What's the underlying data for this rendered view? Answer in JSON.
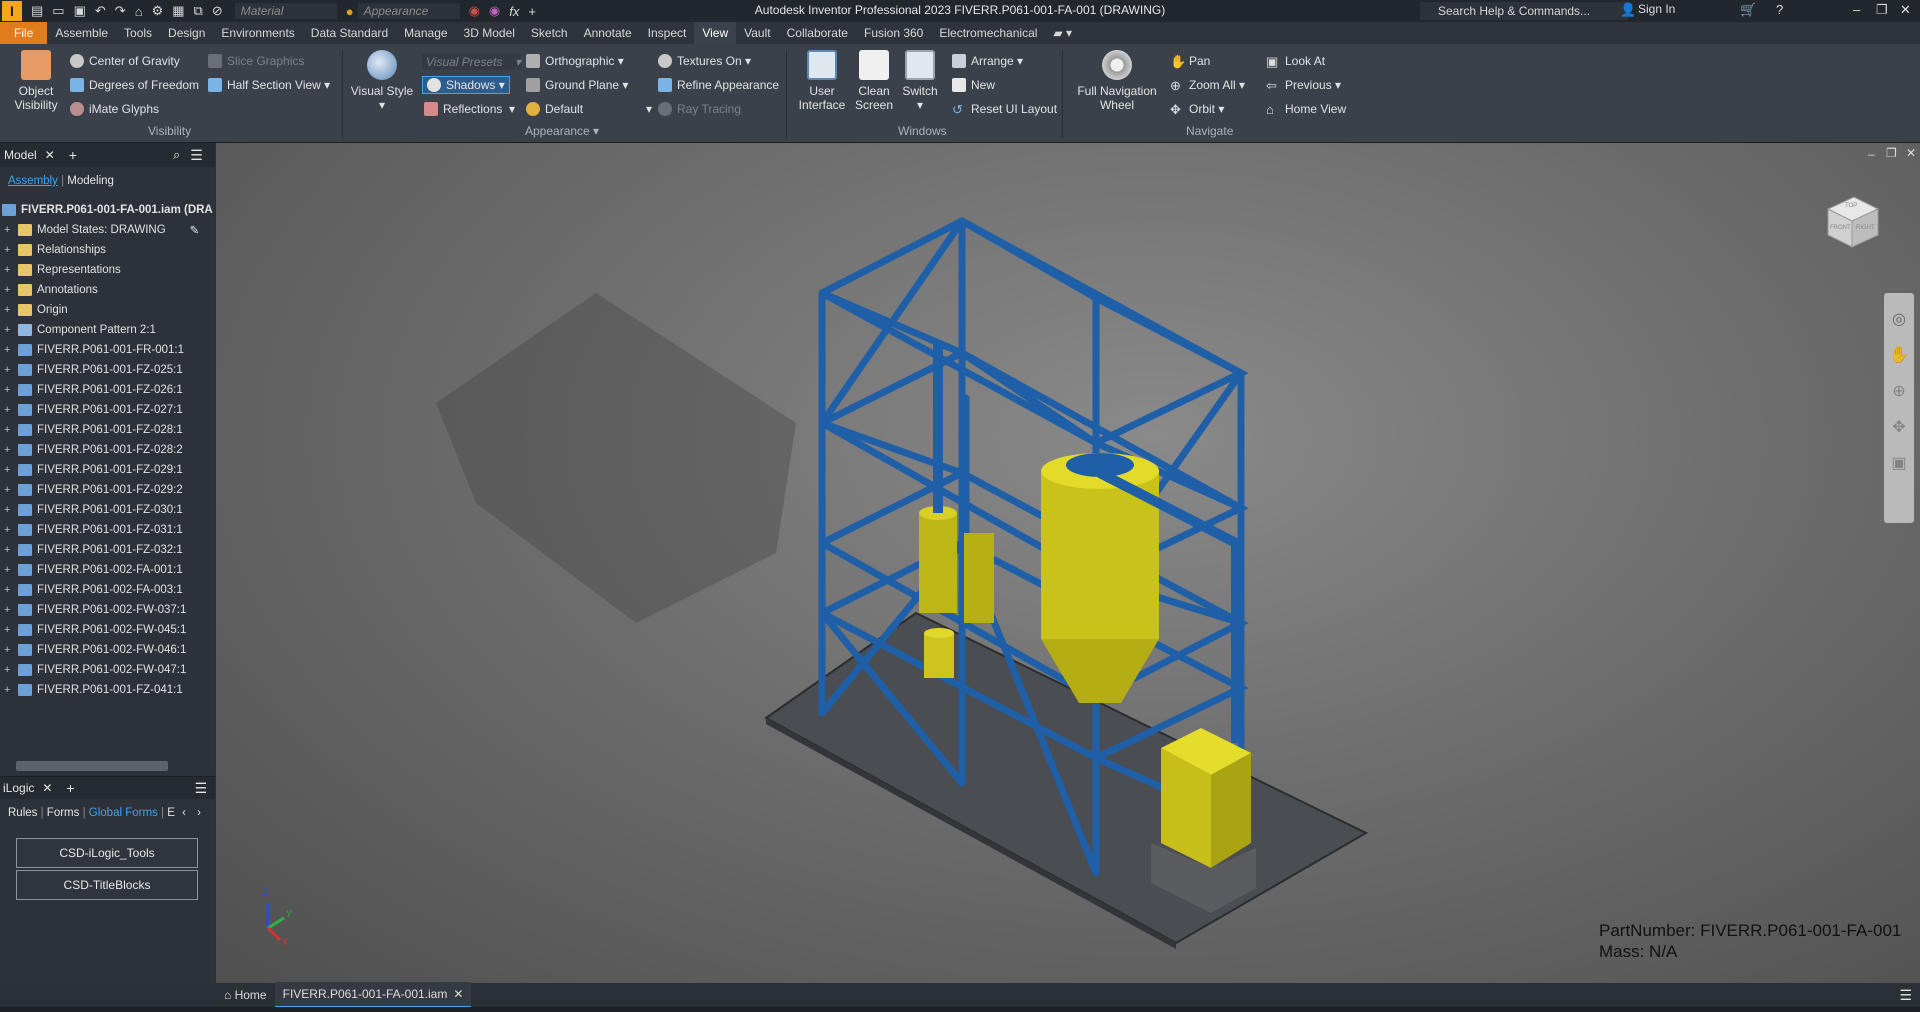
{
  "app": {
    "logo_letter": "I",
    "title": "Autodesk Inventor Professional 2023   FIVERR.P061-001-FA-001 (DRAWING)",
    "material_placeholder": "Material",
    "appearance_placeholder": "Appearance",
    "search_placeholder": "Search Help & Commands...",
    "sign_in": "Sign In"
  },
  "menu_tabs": [
    "File",
    "Assemble",
    "Tools",
    "Design",
    "Environments",
    "Data Standard",
    "Manage",
    "3D Model",
    "Sketch",
    "Annotate",
    "Inspect",
    "View",
    "Vault",
    "Collaborate",
    "Fusion 360",
    "Electromechanical"
  ],
  "active_tab": "View",
  "ribbon": {
    "visibility": {
      "object_visibility": "Object Visibility",
      "center_of_gravity": "Center of Gravity",
      "degrees_of_freedom": "Degrees of Freedom",
      "imate_glyphs": "iMate Glyphs",
      "slice_graphics": "Slice Graphics",
      "half_section_view": "Half Section View",
      "label": "Visibility"
    },
    "appearance": {
      "visual_style": "Visual Style",
      "visual_presets": "Visual Presets",
      "shadows": "Shadows",
      "reflections": "Reflections",
      "orthographic": "Orthographic",
      "ground_plane": "Ground Plane",
      "default": "Default",
      "textures_on": "Textures On",
      "refine_appearance": "Refine Appearance",
      "ray_tracing": "Ray Tracing",
      "label": "Appearance"
    },
    "windows": {
      "user_interface": "User Interface",
      "clean_screen": "Clean Screen",
      "switch": "Switch",
      "arrange": "Arrange",
      "new": "New",
      "reset_ui": "Reset UI Layout",
      "label": "Windows"
    },
    "navigate": {
      "full_nav_wheel": "Full Navigation Wheel",
      "pan": "Pan",
      "zoom_all": "Zoom All",
      "orbit": "Orbit",
      "look_at": "Look At",
      "previous": "Previous",
      "home_view": "Home View",
      "label": "Navigate"
    }
  },
  "browser": {
    "tab": "Model",
    "sub_tabs": [
      "Assembly",
      "Modeling"
    ],
    "root": "FIVERR.P061-001-FA-001.iam (DRA",
    "items": [
      "Model States: DRAWING",
      "Relationships",
      "Representations",
      "Annotations",
      "Origin",
      "Component Pattern 2:1",
      "FIVERR.P061-001-FR-001:1",
      "FIVERR.P061-001-FZ-025:1",
      "FIVERR.P061-001-FZ-026:1",
      "FIVERR.P061-001-FZ-027:1",
      "FIVERR.P061-001-FZ-028:1",
      "FIVERR.P061-001-FZ-028:2",
      "FIVERR.P061-001-FZ-029:1",
      "FIVERR.P061-001-FZ-029:2",
      "FIVERR.P061-001-FZ-030:1",
      "FIVERR.P061-001-FZ-031:1",
      "FIVERR.P061-001-FZ-032:1",
      "FIVERR.P061-002-FA-001:1",
      "FIVERR.P061-002-FA-003:1",
      "FIVERR.P061-002-FW-037:1",
      "FIVERR.P061-002-FW-045:1",
      "FIVERR.P061-002-FW-046:1",
      "FIVERR.P061-002-FW-047:1",
      "FIVERR.P061-001-FZ-041:1"
    ]
  },
  "ilogic": {
    "tab": "iLogic",
    "sub_tabs": [
      "Rules",
      "Forms",
      "Global Forms",
      "E"
    ],
    "active_sub": "Global Forms",
    "buttons": [
      "CSD-iLogic_Tools",
      "CSD-TitleBlocks"
    ]
  },
  "viewport": {
    "part_number": "PartNumber: FIVERR.P061-001-FA-001",
    "mass": "Mass: N/A",
    "viewcube_front": "FRONT",
    "viewcube_right": "RIGHT",
    "viewcube_top": "TOP",
    "axis_x": "X",
    "axis_y": "Y",
    "axis_z": "Z"
  },
  "doc_tabs": {
    "home": "Home",
    "active": "FIVERR.P061-001-FA-001.iam"
  },
  "colors": {
    "accent": "#3ea5ef",
    "file_tab": "#e07c1b",
    "frame_blue": "#1f5fa8",
    "tank_yellow": "#d6cf1e"
  }
}
